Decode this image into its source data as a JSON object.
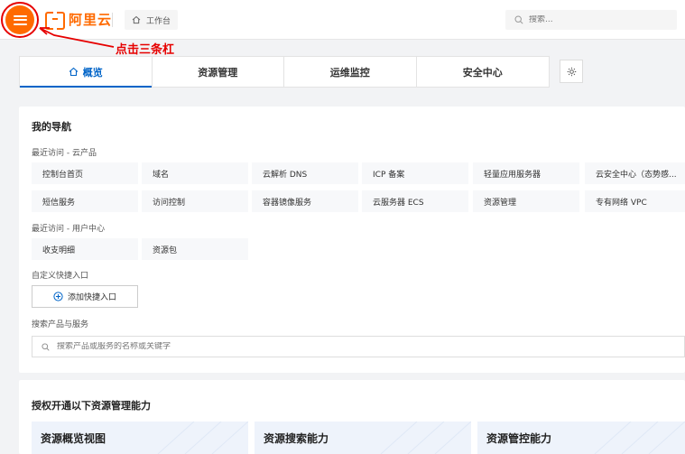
{
  "header": {
    "logo_text": "阿里云",
    "workbench_label": "工作台",
    "search_placeholder": "搜索..."
  },
  "annotation": {
    "text": "点击三条杠",
    "color": "#e60000"
  },
  "tabs": [
    {
      "label": "概览",
      "active": true
    },
    {
      "label": "资源管理",
      "active": false
    },
    {
      "label": "运维监控",
      "active": false
    },
    {
      "label": "安全中心",
      "active": false
    }
  ],
  "nav": {
    "title": "我的导航",
    "recent_products_label": "最近访问 - 云产品",
    "recent_products": [
      "控制台首页",
      "域名",
      "云解析 DNS",
      "ICP 备案",
      "轻量应用服务器",
      "云安全中心（态势感...",
      "短信服务",
      "访问控制",
      "容器镜像服务",
      "云服务器 ECS",
      "资源管理",
      "专有网络 VPC"
    ],
    "recent_user_label": "最近访问 - 用户中心",
    "recent_user": [
      "收支明细",
      "资源包"
    ],
    "custom_label": "自定义快捷入口",
    "add_button": "添加快捷入口",
    "search_label": "搜索产品与服务",
    "search_placeholder": "搜索产品或服务的名称或关键字"
  },
  "capability": {
    "title": "授权开通以下资源管理能力",
    "cards": [
      "资源概览视图",
      "资源搜索能力",
      "资源管控能力"
    ]
  },
  "colors": {
    "brand": "#ff6a00",
    "active_tab": "#0064c8"
  },
  "icons": [
    "menu-icon",
    "home-icon",
    "search-icon",
    "gear-icon",
    "plus-circle-icon"
  ]
}
